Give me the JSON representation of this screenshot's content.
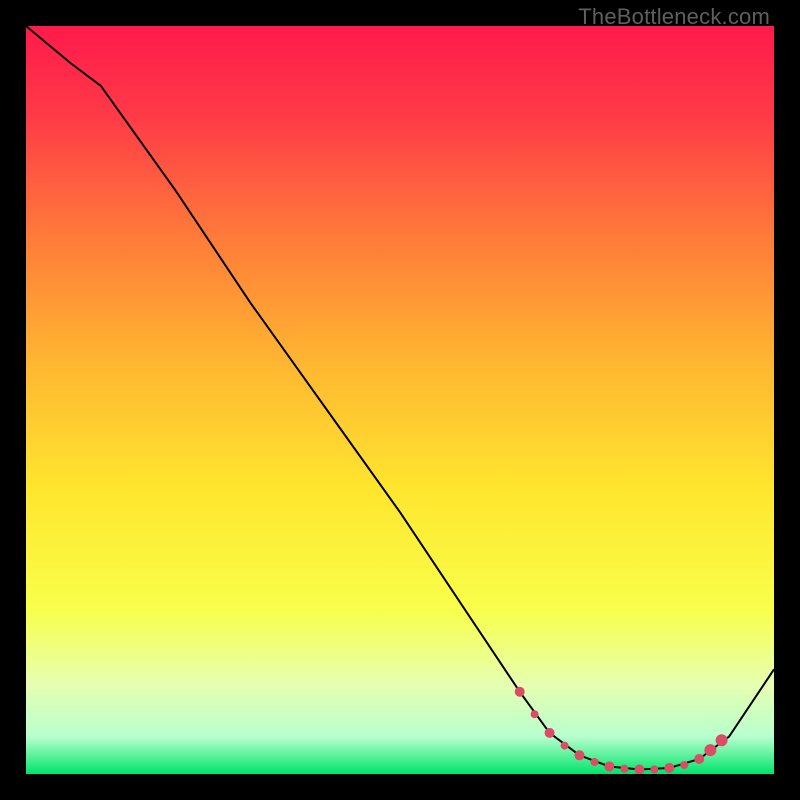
{
  "watermark": "TheBottleneck.com",
  "chart_data": {
    "type": "line",
    "title": "",
    "xlabel": "",
    "ylabel": "",
    "xlim": [
      0,
      100
    ],
    "ylim": [
      0,
      100
    ],
    "background_gradient": {
      "stops": [
        {
          "offset": 0.0,
          "color": "#ff1a4b"
        },
        {
          "offset": 0.12,
          "color": "#ff3a47"
        },
        {
          "offset": 0.28,
          "color": "#ff7a3a"
        },
        {
          "offset": 0.45,
          "color": "#ffb631"
        },
        {
          "offset": 0.62,
          "color": "#ffe62e"
        },
        {
          "offset": 0.78,
          "color": "#f8ff4a"
        },
        {
          "offset": 0.88,
          "color": "#e6ffb0"
        },
        {
          "offset": 0.95,
          "color": "#b8ffce"
        },
        {
          "offset": 1.0,
          "color": "#00e46a"
        }
      ]
    },
    "series": [
      {
        "name": "bottleneck-curve",
        "x": [
          0,
          6,
          10,
          20,
          30,
          40,
          50,
          60,
          66,
          70,
          74,
          78,
          82,
          86,
          90,
          94,
          100
        ],
        "y": [
          100,
          95,
          92,
          78,
          63,
          49,
          35,
          20,
          11,
          5.5,
          2.5,
          1.0,
          0.6,
          0.8,
          2.0,
          5.0,
          14
        ]
      }
    ],
    "markers": {
      "name": "optimal-zone-dots",
      "x": [
        66,
        68,
        70,
        72,
        74,
        76,
        78,
        80,
        82,
        84,
        86,
        88,
        90,
        91.5,
        93
      ],
      "y": [
        11.0,
        8.0,
        5.5,
        3.8,
        2.5,
        1.6,
        1.0,
        0.7,
        0.6,
        0.6,
        0.8,
        1.2,
        2.0,
        3.2,
        4.5
      ],
      "size": [
        5,
        4,
        5,
        4,
        5,
        4,
        5,
        4,
        5,
        4,
        5,
        4,
        5,
        6,
        6
      ],
      "color": "#da4d64"
    }
  }
}
